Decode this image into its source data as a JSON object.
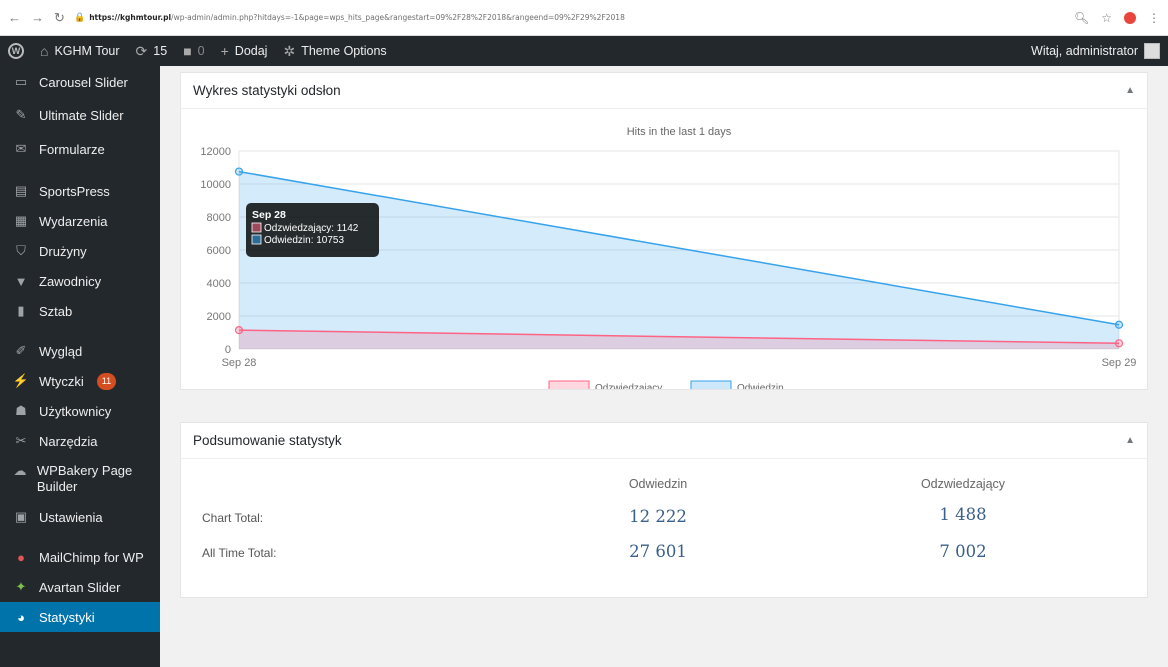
{
  "browser": {
    "url_host": "https://kghmtour.pl",
    "url_path": "/wp-admin/admin.php?hitdays=-1&page=wps_hits_page&rangestart=09%2F28%2F2018&rangeend=09%2F29%2F2018"
  },
  "adminbar": {
    "site_name": "KGHM Tour",
    "updates_count": "15",
    "comments_count": "0",
    "new_label": "Dodaj",
    "theme_options": "Theme Options",
    "greeting": "Witaj, administrator"
  },
  "sidebar": {
    "items": [
      {
        "label": "Carousel Slider",
        "icon": "slider-icon"
      },
      {
        "label": "Ultimate Slider",
        "icon": "pin-icon"
      },
      {
        "label": "Formularze",
        "icon": "envelope-icon"
      },
      {
        "label": "SportsPress",
        "icon": "sportspress-icon"
      },
      {
        "label": "Wydarzenia",
        "icon": "calendar-icon"
      },
      {
        "label": "Drużyny",
        "icon": "shield-icon"
      },
      {
        "label": "Zawodnicy",
        "icon": "shirt-icon"
      },
      {
        "label": "Sztab",
        "icon": "id-card-icon"
      },
      {
        "label": "Wygląd",
        "icon": "brush-icon"
      },
      {
        "label": "Wtyczki",
        "icon": "plugin-icon",
        "badge": "11"
      },
      {
        "label": "Użytkownicy",
        "icon": "users-icon"
      },
      {
        "label": "Narzędzia",
        "icon": "wrench-icon"
      },
      {
        "label": "WPBakery Page Builder",
        "icon": "wpbakery-icon"
      },
      {
        "label": "Ustawienia",
        "icon": "settings-icon"
      },
      {
        "label": "MailChimp for WP",
        "icon": "mailchimp-icon"
      },
      {
        "label": "Avartan Slider",
        "icon": "avartan-icon"
      },
      {
        "label": "Statystyki",
        "icon": "pie-chart-icon"
      }
    ]
  },
  "chart_panel": {
    "title": "Wykres statystyki odsłon"
  },
  "chart_data": {
    "type": "area",
    "title": "Hits in the last 1 days",
    "categories": [
      "Sep 28",
      "Sep 29"
    ],
    "series": [
      {
        "name": "Odwiedzin",
        "values": [
          10753,
          1469
        ],
        "color": "#36a2eb"
      },
      {
        "name": "Odzwiedzający",
        "values": [
          1142,
          346
        ],
        "color": "#ff6384"
      }
    ],
    "ylim": [
      0,
      12000
    ],
    "yticks": [
      0,
      2000,
      4000,
      6000,
      8000,
      10000,
      12000
    ],
    "grid": true,
    "legend": "bottom",
    "tooltip": {
      "title": "Sep 28",
      "lines": [
        "Odzwiedzający: 1142",
        "Odwiedzin: 10753"
      ]
    }
  },
  "summary_panel": {
    "title": "Podsumowanie statystyk",
    "columns": [
      "Odwiedzin",
      "Odzwiedzający"
    ],
    "rows": [
      {
        "label": "Chart Total:",
        "values": [
          "12 222",
          "1 488"
        ]
      },
      {
        "label": "All Time Total:",
        "values": [
          "27 601",
          "7 002"
        ]
      }
    ]
  },
  "colors": {
    "adminbar": "#23282d",
    "active_menu": "#0073aa",
    "badge": "#d54e21"
  }
}
